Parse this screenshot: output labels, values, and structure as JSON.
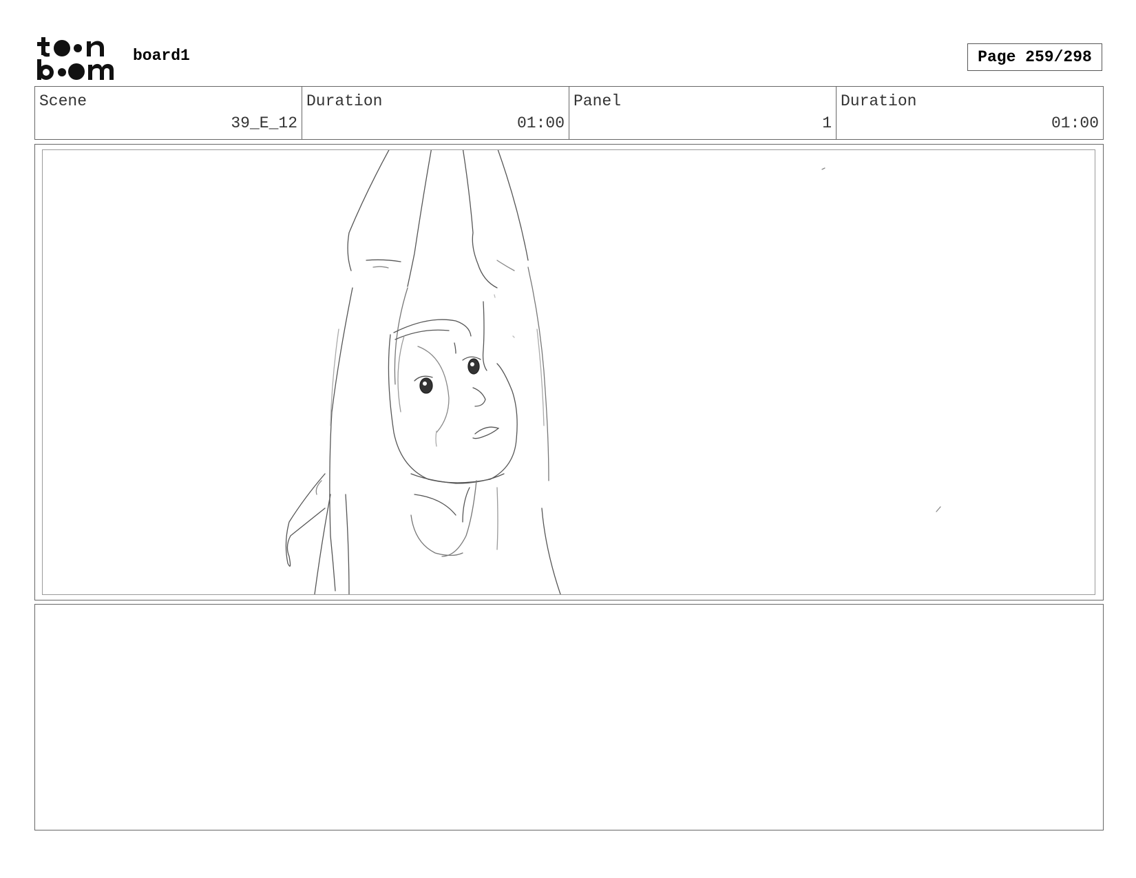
{
  "header": {
    "logo_line1": "toon",
    "logo_line2": "boom",
    "board_name": "board1",
    "page_label": "Page 259/298"
  },
  "info": [
    {
      "label": "Scene",
      "value": "39_E_12"
    },
    {
      "label": "Duration",
      "value": "01:00"
    },
    {
      "label": "Panel",
      "value": "1"
    },
    {
      "label": "Duration",
      "value": "01:00"
    }
  ],
  "notes": {
    "text": ""
  }
}
